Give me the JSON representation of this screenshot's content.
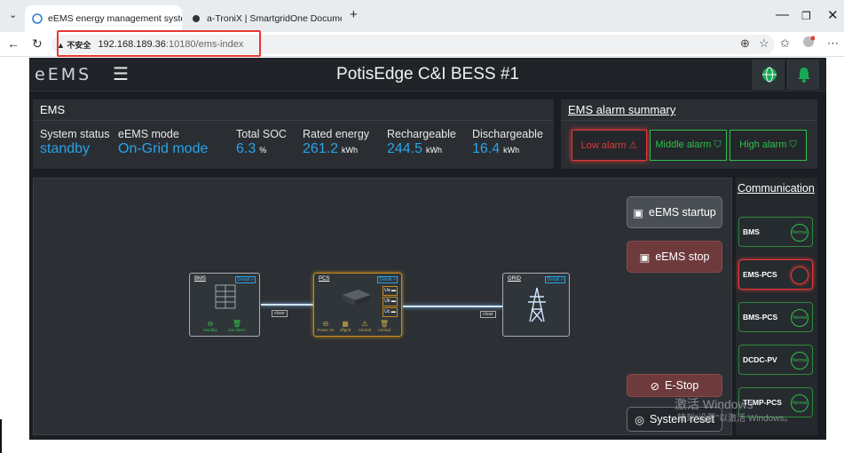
{
  "browser": {
    "tabs": [
      {
        "title": "eEMS energy management system"
      },
      {
        "title": "a-TroniX | SmartgridOne Documen"
      }
    ],
    "url_warning": "不安全",
    "url_host": "192.168.189.36",
    "url_path": ":10180/ems-index"
  },
  "app": {
    "logo": "eEMS",
    "menu_icon": "☰",
    "title": "PotisEdge C&I BESS #1",
    "ems": {
      "heading": "EMS",
      "metrics": [
        {
          "label": "System status",
          "value": "standby",
          "unit": ""
        },
        {
          "label": "eEMS mode",
          "value": "On-Grid mode",
          "unit": ""
        },
        {
          "label": "Total SOC",
          "value": "6.3",
          "unit": "%"
        },
        {
          "label": "Rated energy",
          "value": "261.2",
          "unit": "kWh"
        },
        {
          "label": "Rechargeable",
          "value": "244.5",
          "unit": "kWh"
        },
        {
          "label": "Dischargeable",
          "value": "16.4",
          "unit": "kWh"
        }
      ]
    },
    "alarm": {
      "heading": "EMS alarm summary",
      "buttons": [
        {
          "label": "Low alarm ⚠",
          "color": "#e53935"
        },
        {
          "label": "Middle alarm ⛉",
          "color": "#2fc04a"
        },
        {
          "label": "High alarm ⛉",
          "color": "#2fc04a"
        }
      ]
    },
    "diagram": {
      "bms": {
        "name": "BMS",
        "detail": "Detail »",
        "states": [
          "standby",
          "low alarm"
        ]
      },
      "pcs": {
        "name": "PCS",
        "detail": "Detail »",
        "ports": [
          "Ua ▬",
          "Ub ▬",
          "Uc ▬"
        ],
        "states": [
          "Power on",
          "offgrid",
          "normal",
          "normal"
        ]
      },
      "grid": {
        "name": "GRID",
        "detail": "Detail »"
      },
      "switch_left": "close",
      "switch_mid": "close",
      "switch_right": "close"
    },
    "controls": {
      "startup": "eEMS startup",
      "stop": "eEMS stop",
      "estop": "E-Stop",
      "reset": "System reset"
    },
    "communication": {
      "heading": "Communication",
      "items": [
        {
          "label": "BMS",
          "status": "Normal",
          "state": "ok"
        },
        {
          "label": "EMS-PCS",
          "status": "",
          "state": "error"
        },
        {
          "label": "BMS-PCS",
          "status": "Normal",
          "state": "ok"
        },
        {
          "label": "DCDC-PV",
          "status": "Normal",
          "state": "ok"
        },
        {
          "label": "TEMP-PCS",
          "status": "Normal",
          "state": "ok"
        }
      ]
    }
  },
  "watermark": {
    "line1": "激活 Windows",
    "line2": "转到\"设置\"以激活 Windows。"
  }
}
